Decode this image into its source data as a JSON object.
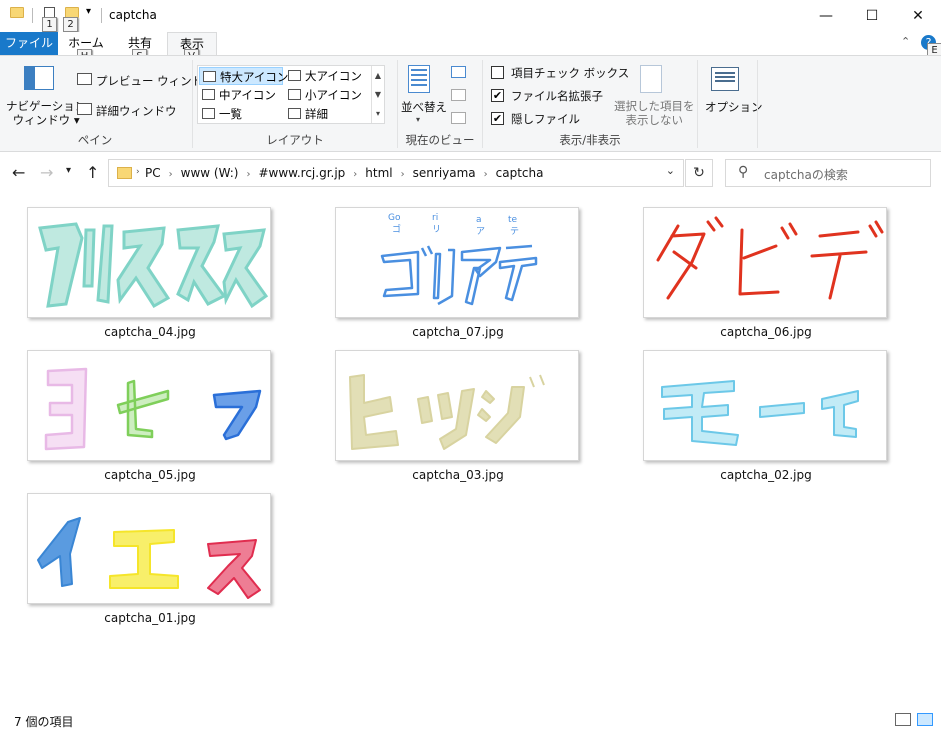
{
  "window": {
    "title": "captcha",
    "keytips": {
      "qa1": "1",
      "qa2": "2",
      "home": "H",
      "share": "S",
      "view": "V",
      "help": "E"
    }
  },
  "tabs": {
    "file": "ファイル",
    "home": "ホーム",
    "share": "共有",
    "view": "表示"
  },
  "ribbon": {
    "pane": {
      "nav_pane": "ナビゲーション\nウィンドウ ▾",
      "preview": "プレビュー ウィンドウ",
      "details": "詳細ウィンドウ",
      "label": "ペイン"
    },
    "layout": {
      "items": [
        "特大アイコン",
        "大アイコン",
        "中アイコン",
        "小アイコン",
        "一覧",
        "詳細"
      ],
      "label": "レイアウト"
    },
    "current_view": {
      "sort": "並べ替え",
      "label": "現在のビュー"
    },
    "show_hide": {
      "item_checkboxes": "項目チェック ボックス",
      "file_extensions": "ファイル名拡張子",
      "hidden_items": "隠しファイル",
      "hide_selected": "選択した項目を\n表示しない",
      "label": "表示/非表示"
    },
    "options": "オプション"
  },
  "address": {
    "crumbs": [
      "PC",
      "www (W:)",
      "#www.rcj.gr.jp",
      "html",
      "senriyama",
      "captcha"
    ],
    "search_placeholder": "captchaの検索"
  },
  "files": [
    {
      "name": "captcha_04.jpg",
      "text": "クリスマス",
      "color": "#7fd3c6"
    },
    {
      "name": "captcha_07.jpg",
      "text": "ゴリアテ",
      "color": "#4a8fe0",
      "romaji": [
        "Go",
        "ri",
        "a",
        "te"
      ],
      "kana": [
        "ゴ",
        "リ",
        "ア",
        "テ"
      ]
    },
    {
      "name": "captcha_06.jpg",
      "text": "ダビデ",
      "color": "#e0331f"
    },
    {
      "name": "captcha_05.jpg",
      "text": "ヨセフ",
      "colors": [
        "#e8b9e6",
        "#7fcf5a",
        "#2a6fd8"
      ]
    },
    {
      "name": "captcha_03.jpg",
      "text": "ヒツジ",
      "color": "#d8d3a0"
    },
    {
      "name": "captcha_02.jpg",
      "text": "モーセ",
      "color": "#6cc8e8"
    },
    {
      "name": "captcha_01.jpg",
      "text": "イエス",
      "colors": [
        "#3a86d4",
        "#f5e52a",
        "#e02d4f"
      ]
    }
  ],
  "status": {
    "item_count": "7 個の項目"
  }
}
